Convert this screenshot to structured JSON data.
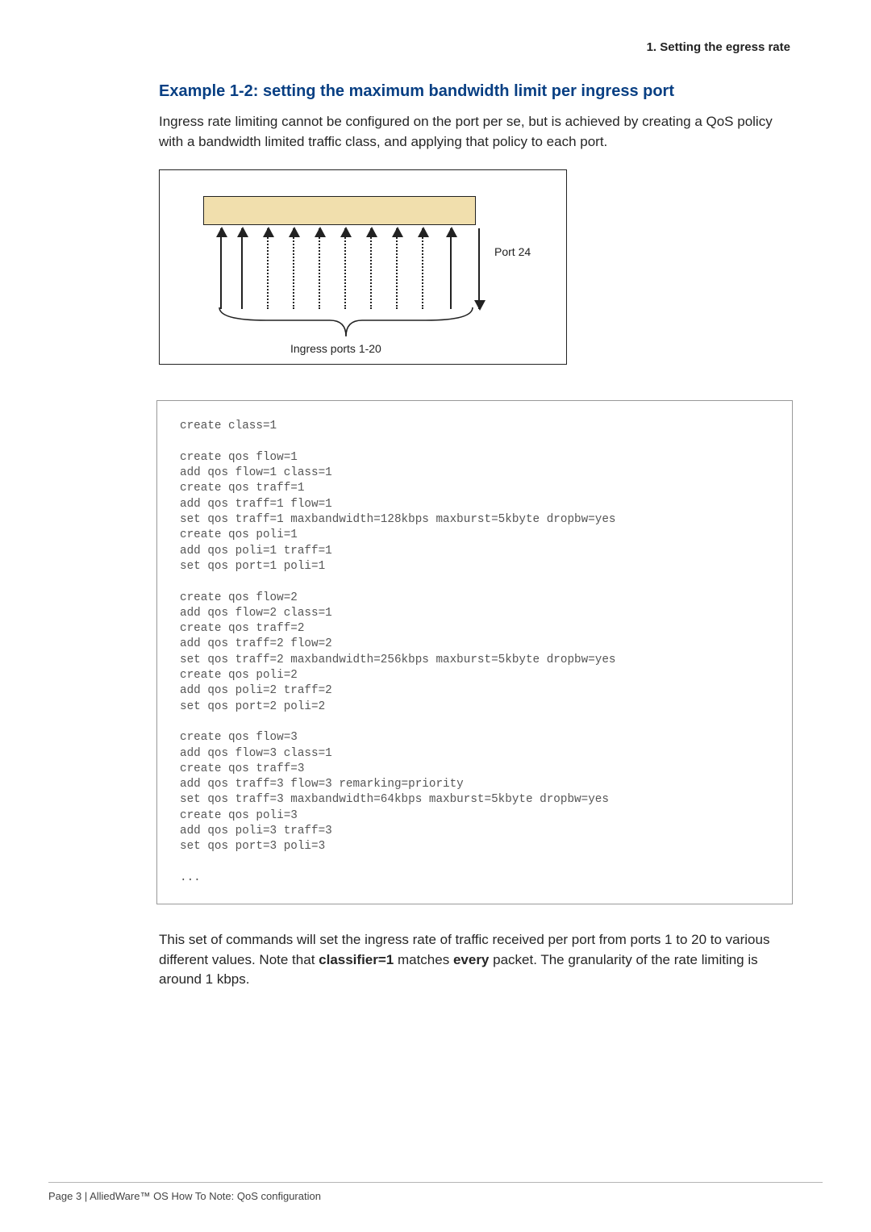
{
  "header": {
    "section_label": "1. Setting the egress rate"
  },
  "content": {
    "heading": "Example 1-2: setting the maximum bandwidth limit per ingress port",
    "intro": "Ingress rate limiting cannot be configured on the port per se, but is achieved by creating a QoS policy with a bandwidth limited traffic class, and applying that policy to each port.",
    "diagram": {
      "port_label": "Port 24",
      "ingress_label": "Ingress ports 1-20"
    },
    "code": "create class=1\n\ncreate qos flow=1\nadd qos flow=1 class=1\ncreate qos traff=1\nadd qos traff=1 flow=1\nset qos traff=1 maxbandwidth=128kbps maxburst=5kbyte dropbw=yes\ncreate qos poli=1\nadd qos poli=1 traff=1\nset qos port=1 poli=1\n\ncreate qos flow=2\nadd qos flow=2 class=1\ncreate qos traff=2\nadd qos traff=2 flow=2\nset qos traff=2 maxbandwidth=256kbps maxburst=5kbyte dropbw=yes\ncreate qos poli=2\nadd qos poli=2 traff=2\nset qos port=2 poli=2\n\ncreate qos flow=3\nadd qos flow=3 class=1\ncreate qos traff=3\nadd qos traff=3 flow=3 remarking=priority\nset qos traff=3 maxbandwidth=64kbps maxburst=5kbyte dropbw=yes\ncreate qos poli=3\nadd qos poli=3 traff=3\nset qos port=3 poli=3\n\n...",
    "outro_pre": "This set of commands will set the ingress rate of traffic received per port from ports 1 to 20 to various different values. Note that ",
    "outro_bold1": "classifier=1",
    "outro_mid": " matches ",
    "outro_bold2": "every",
    "outro_post": " packet. The granularity of the rate limiting is around 1 kbps."
  },
  "footer": {
    "text": "Page 3 | AlliedWare™ OS How To Note: QoS configuration"
  }
}
